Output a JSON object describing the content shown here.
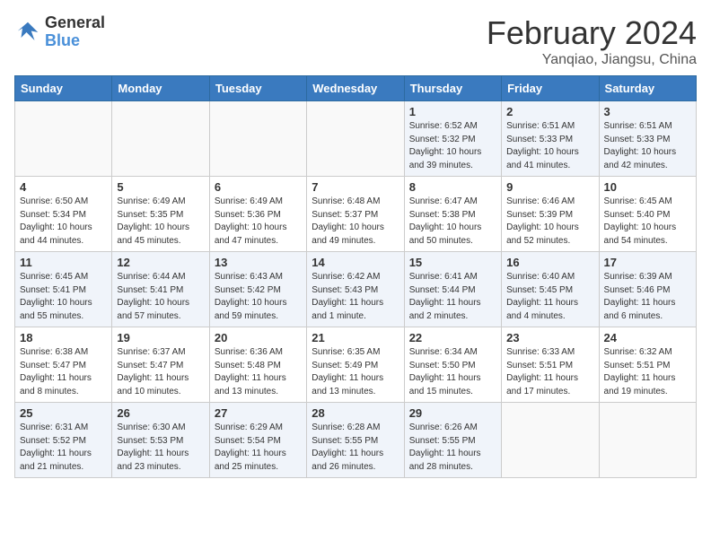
{
  "header": {
    "logo_text_general": "General",
    "logo_text_blue": "Blue",
    "title": "February 2024",
    "subtitle": "Yanqiao, Jiangsu, China"
  },
  "weekdays": [
    "Sunday",
    "Monday",
    "Tuesday",
    "Wednesday",
    "Thursday",
    "Friday",
    "Saturday"
  ],
  "weeks": [
    [
      {
        "num": "",
        "sunrise": "",
        "sunset": "",
        "daylight": ""
      },
      {
        "num": "",
        "sunrise": "",
        "sunset": "",
        "daylight": ""
      },
      {
        "num": "",
        "sunrise": "",
        "sunset": "",
        "daylight": ""
      },
      {
        "num": "",
        "sunrise": "",
        "sunset": "",
        "daylight": ""
      },
      {
        "num": "1",
        "sunrise": "Sunrise: 6:52 AM",
        "sunset": "Sunset: 5:32 PM",
        "daylight": "Daylight: 10 hours and 39 minutes."
      },
      {
        "num": "2",
        "sunrise": "Sunrise: 6:51 AM",
        "sunset": "Sunset: 5:33 PM",
        "daylight": "Daylight: 10 hours and 41 minutes."
      },
      {
        "num": "3",
        "sunrise": "Sunrise: 6:51 AM",
        "sunset": "Sunset: 5:33 PM",
        "daylight": "Daylight: 10 hours and 42 minutes."
      }
    ],
    [
      {
        "num": "4",
        "sunrise": "Sunrise: 6:50 AM",
        "sunset": "Sunset: 5:34 PM",
        "daylight": "Daylight: 10 hours and 44 minutes."
      },
      {
        "num": "5",
        "sunrise": "Sunrise: 6:49 AM",
        "sunset": "Sunset: 5:35 PM",
        "daylight": "Daylight: 10 hours and 45 minutes."
      },
      {
        "num": "6",
        "sunrise": "Sunrise: 6:49 AM",
        "sunset": "Sunset: 5:36 PM",
        "daylight": "Daylight: 10 hours and 47 minutes."
      },
      {
        "num": "7",
        "sunrise": "Sunrise: 6:48 AM",
        "sunset": "Sunset: 5:37 PM",
        "daylight": "Daylight: 10 hours and 49 minutes."
      },
      {
        "num": "8",
        "sunrise": "Sunrise: 6:47 AM",
        "sunset": "Sunset: 5:38 PM",
        "daylight": "Daylight: 10 hours and 50 minutes."
      },
      {
        "num": "9",
        "sunrise": "Sunrise: 6:46 AM",
        "sunset": "Sunset: 5:39 PM",
        "daylight": "Daylight: 10 hours and 52 minutes."
      },
      {
        "num": "10",
        "sunrise": "Sunrise: 6:45 AM",
        "sunset": "Sunset: 5:40 PM",
        "daylight": "Daylight: 10 hours and 54 minutes."
      }
    ],
    [
      {
        "num": "11",
        "sunrise": "Sunrise: 6:45 AM",
        "sunset": "Sunset: 5:41 PM",
        "daylight": "Daylight: 10 hours and 55 minutes."
      },
      {
        "num": "12",
        "sunrise": "Sunrise: 6:44 AM",
        "sunset": "Sunset: 5:41 PM",
        "daylight": "Daylight: 10 hours and 57 minutes."
      },
      {
        "num": "13",
        "sunrise": "Sunrise: 6:43 AM",
        "sunset": "Sunset: 5:42 PM",
        "daylight": "Daylight: 10 hours and 59 minutes."
      },
      {
        "num": "14",
        "sunrise": "Sunrise: 6:42 AM",
        "sunset": "Sunset: 5:43 PM",
        "daylight": "Daylight: 11 hours and 1 minute."
      },
      {
        "num": "15",
        "sunrise": "Sunrise: 6:41 AM",
        "sunset": "Sunset: 5:44 PM",
        "daylight": "Daylight: 11 hours and 2 minutes."
      },
      {
        "num": "16",
        "sunrise": "Sunrise: 6:40 AM",
        "sunset": "Sunset: 5:45 PM",
        "daylight": "Daylight: 11 hours and 4 minutes."
      },
      {
        "num": "17",
        "sunrise": "Sunrise: 6:39 AM",
        "sunset": "Sunset: 5:46 PM",
        "daylight": "Daylight: 11 hours and 6 minutes."
      }
    ],
    [
      {
        "num": "18",
        "sunrise": "Sunrise: 6:38 AM",
        "sunset": "Sunset: 5:47 PM",
        "daylight": "Daylight: 11 hours and 8 minutes."
      },
      {
        "num": "19",
        "sunrise": "Sunrise: 6:37 AM",
        "sunset": "Sunset: 5:47 PM",
        "daylight": "Daylight: 11 hours and 10 minutes."
      },
      {
        "num": "20",
        "sunrise": "Sunrise: 6:36 AM",
        "sunset": "Sunset: 5:48 PM",
        "daylight": "Daylight: 11 hours and 13 minutes."
      },
      {
        "num": "21",
        "sunrise": "Sunrise: 6:35 AM",
        "sunset": "Sunset: 5:49 PM",
        "daylight": "Daylight: 11 hours and 13 minutes."
      },
      {
        "num": "22",
        "sunrise": "Sunrise: 6:34 AM",
        "sunset": "Sunset: 5:50 PM",
        "daylight": "Daylight: 11 hours and 15 minutes."
      },
      {
        "num": "23",
        "sunrise": "Sunrise: 6:33 AM",
        "sunset": "Sunset: 5:51 PM",
        "daylight": "Daylight: 11 hours and 17 minutes."
      },
      {
        "num": "24",
        "sunrise": "Sunrise: 6:32 AM",
        "sunset": "Sunset: 5:51 PM",
        "daylight": "Daylight: 11 hours and 19 minutes."
      }
    ],
    [
      {
        "num": "25",
        "sunrise": "Sunrise: 6:31 AM",
        "sunset": "Sunset: 5:52 PM",
        "daylight": "Daylight: 11 hours and 21 minutes."
      },
      {
        "num": "26",
        "sunrise": "Sunrise: 6:30 AM",
        "sunset": "Sunset: 5:53 PM",
        "daylight": "Daylight: 11 hours and 23 minutes."
      },
      {
        "num": "27",
        "sunrise": "Sunrise: 6:29 AM",
        "sunset": "Sunset: 5:54 PM",
        "daylight": "Daylight: 11 hours and 25 minutes."
      },
      {
        "num": "28",
        "sunrise": "Sunrise: 6:28 AM",
        "sunset": "Sunset: 5:55 PM",
        "daylight": "Daylight: 11 hours and 26 minutes."
      },
      {
        "num": "29",
        "sunrise": "Sunrise: 6:26 AM",
        "sunset": "Sunset: 5:55 PM",
        "daylight": "Daylight: 11 hours and 28 minutes."
      },
      {
        "num": "",
        "sunrise": "",
        "sunset": "",
        "daylight": ""
      },
      {
        "num": "",
        "sunrise": "",
        "sunset": "",
        "daylight": ""
      }
    ]
  ]
}
